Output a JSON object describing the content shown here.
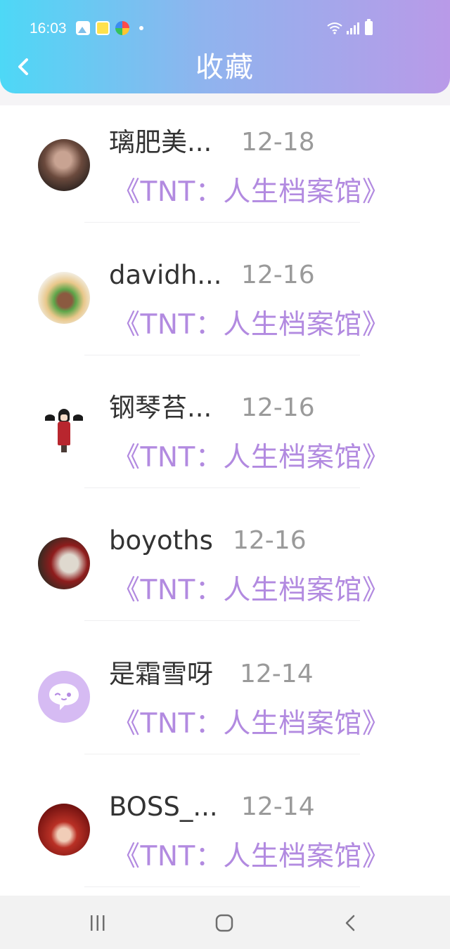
{
  "status_bar": {
    "time": "16:03",
    "icons": [
      "gallery-icon",
      "app-notification-icon",
      "colorful-app-icon",
      "notification-dot-icon",
      "wifi-icon",
      "signal-icon",
      "battery-icon"
    ]
  },
  "header": {
    "title": "收藏",
    "back_icon": "chevron-left-icon",
    "gradient": [
      "#4dd8f6",
      "#b99ae8"
    ]
  },
  "favorites": [
    {
      "username": "璃肥美...",
      "date": "12-18",
      "book": "《TNT：人生档案馆》",
      "avatar": "photo-avatar"
    },
    {
      "username": "davidh...",
      "date": "12-16",
      "book": "《TNT：人生档案馆》",
      "avatar": "food-avatar"
    },
    {
      "username": "钢琴苔...",
      "date": "12-16",
      "book": "《TNT：人生档案馆》",
      "avatar": "chibi-avatar"
    },
    {
      "username": "boyoths",
      "date": "12-16",
      "book": "《TNT：人生档案馆》",
      "avatar": "brooch-avatar"
    },
    {
      "username": "是霜雪呀",
      "date": "12-14",
      "book": "《TNT：人生档案馆》",
      "avatar": "default-chat-avatar"
    },
    {
      "username": "BOSS_...",
      "date": "12-14",
      "book": "《TNT：人生档案馆》",
      "avatar": "red-hood-avatar"
    }
  ],
  "colors": {
    "book_title": "#b28ae0",
    "username": "#333333",
    "date": "#9a9a9a",
    "default_avatar_bg": "#d6bbf3"
  },
  "nav_bar": {
    "icons": [
      "recent-apps-icon",
      "home-icon",
      "back-icon"
    ]
  }
}
